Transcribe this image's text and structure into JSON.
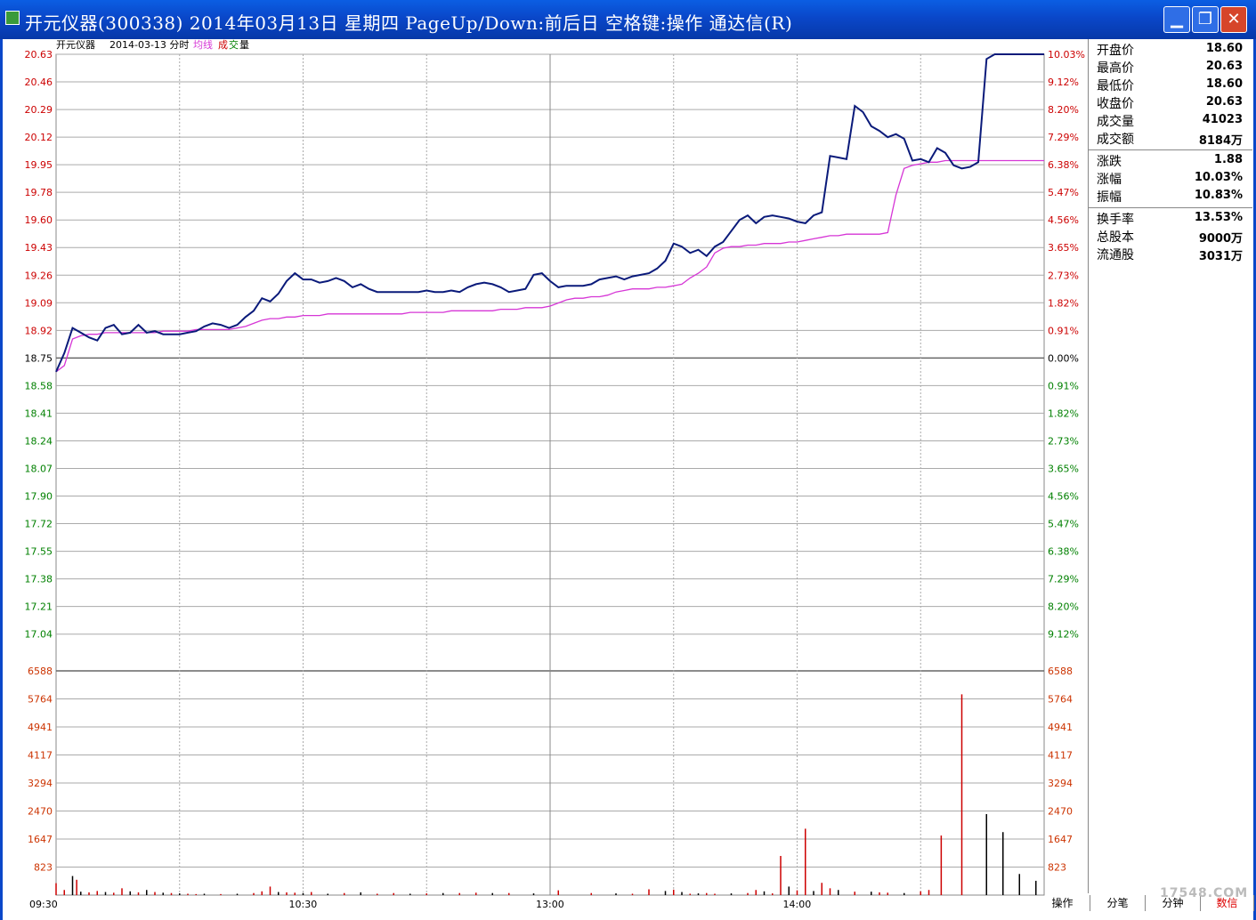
{
  "window": {
    "title": "开元仪器(300338) 2014年03月13日 星期四 PageUp/Down:前后日 空格键:操作 通达信(R)",
    "min_label": "▁",
    "max_label": "❐",
    "close_label": "✕"
  },
  "header": {
    "stock_name": "开元仪器",
    "date_label": "2014-03-13 分时",
    "avg_label": "均线",
    "vol_label_a": "成",
    "vol_label_b": "交",
    "vol_label_c": "量"
  },
  "colors": {
    "price": "#0a1a7a",
    "avg": "#d636d6",
    "up": "#cc0000",
    "down": "#008000",
    "vol_up": "#cc0000",
    "vol_down": "#000000"
  },
  "chart_data": {
    "type": "line",
    "title": "开元仪器 2014-03-13 分时",
    "prev_close": 18.75,
    "price_axis_left": [
      "20.63",
      "20.46",
      "20.29",
      "20.12",
      "19.95",
      "19.78",
      "19.60",
      "19.43",
      "19.26",
      "19.09",
      "18.92",
      "18.75",
      "18.58",
      "18.41",
      "18.24",
      "18.07",
      "17.90",
      "17.72",
      "17.55",
      "17.38",
      "17.21",
      "17.04"
    ],
    "percent_axis_right": [
      "10.03%",
      "9.12%",
      "8.20%",
      "7.29%",
      "6.38%",
      "5.47%",
      "4.56%",
      "3.65%",
      "2.73%",
      "1.82%",
      "0.91%",
      "0.00%",
      "0.91%",
      "1.82%",
      "2.73%",
      "3.65%",
      "4.56%",
      "5.47%",
      "6.38%",
      "7.29%",
      "8.20%",
      "9.12%"
    ],
    "volume_axis": [
      "6588",
      "5764",
      "4941",
      "4117",
      "3294",
      "2470",
      "1647",
      "823"
    ],
    "time_labels": [
      "09:30",
      "10:30",
      "13:00",
      "14:00"
    ],
    "ylim_price": [
      16.87,
      20.63
    ],
    "ylim_volume": [
      0,
      6588
    ],
    "series": [
      {
        "name": "价格",
        "x": [
          0,
          2,
          4,
          6,
          8,
          10,
          12,
          14,
          16,
          18,
          20,
          22,
          24,
          26,
          28,
          30,
          32,
          34,
          36,
          38,
          40,
          42,
          44,
          46,
          48,
          50,
          52,
          54,
          56,
          58,
          60,
          62,
          64,
          66,
          68,
          70,
          72,
          74,
          76,
          78,
          80,
          82,
          84,
          86,
          88,
          90,
          92,
          94,
          96,
          98,
          100,
          102,
          104,
          106,
          108,
          110,
          112,
          114,
          116,
          118,
          120,
          122,
          124,
          126,
          128,
          130,
          132,
          134,
          136,
          138,
          140,
          142,
          144,
          146,
          148,
          150,
          152,
          154,
          156,
          158,
          160,
          162,
          164,
          166,
          168,
          170,
          172,
          174,
          176,
          178,
          180,
          182,
          184,
          186,
          188,
          190,
          192,
          194,
          196,
          198,
          200,
          202,
          204,
          206,
          208,
          210,
          212,
          214,
          216,
          218,
          220,
          222,
          224,
          226,
          228,
          230,
          232,
          234,
          236,
          238,
          240
        ],
        "values": [
          18.6,
          18.72,
          18.88,
          18.85,
          18.82,
          18.8,
          18.88,
          18.9,
          18.84,
          18.85,
          18.9,
          18.85,
          18.86,
          18.84,
          18.84,
          18.84,
          18.85,
          18.86,
          18.89,
          18.91,
          18.9,
          18.88,
          18.9,
          18.95,
          18.99,
          19.07,
          19.05,
          19.1,
          19.18,
          19.23,
          19.19,
          19.19,
          19.17,
          19.18,
          19.2,
          19.18,
          19.14,
          19.16,
          19.13,
          19.11,
          19.11,
          19.11,
          19.11,
          19.11,
          19.11,
          19.12,
          19.11,
          19.11,
          19.12,
          19.11,
          19.14,
          19.16,
          19.17,
          19.16,
          19.14,
          19.11,
          19.12,
          19.13,
          19.22,
          19.23,
          19.18,
          19.14,
          19.15,
          19.15,
          19.15,
          19.16,
          19.19,
          19.2,
          19.21,
          19.19,
          19.21,
          19.22,
          19.23,
          19.26,
          19.31,
          19.42,
          19.4,
          19.36,
          19.38,
          19.34,
          19.4,
          19.43,
          19.5,
          19.57,
          19.6,
          19.55,
          19.59,
          19.6,
          19.59,
          19.58,
          19.56,
          19.55,
          19.6,
          19.62,
          19.98,
          19.97,
          19.96,
          20.3,
          20.26,
          20.17,
          20.14,
          20.1,
          20.12,
          20.09,
          19.95,
          19.96,
          19.94,
          20.03,
          20.0,
          19.92,
          19.9,
          19.91,
          19.94,
          20.6,
          20.63,
          20.63,
          20.63,
          20.63,
          20.63,
          20.63,
          20.63
        ]
      },
      {
        "name": "均线",
        "x": [
          0,
          2,
          4,
          6,
          8,
          10,
          12,
          14,
          16,
          18,
          20,
          22,
          24,
          26,
          28,
          30,
          32,
          34,
          36,
          38,
          40,
          42,
          44,
          46,
          48,
          50,
          52,
          54,
          56,
          58,
          60,
          62,
          64,
          66,
          68,
          70,
          72,
          74,
          76,
          78,
          80,
          82,
          84,
          86,
          88,
          90,
          92,
          94,
          96,
          98,
          100,
          102,
          104,
          106,
          108,
          110,
          112,
          114,
          116,
          118,
          120,
          122,
          124,
          126,
          128,
          130,
          132,
          134,
          136,
          138,
          140,
          142,
          144,
          146,
          148,
          150,
          152,
          154,
          156,
          158,
          160,
          162,
          164,
          166,
          168,
          170,
          172,
          174,
          176,
          178,
          180,
          182,
          184,
          186,
          188,
          190,
          192,
          194,
          196,
          198,
          200,
          202,
          204,
          206,
          208,
          210,
          212,
          214,
          216,
          218,
          220,
          222,
          224,
          226,
          228,
          230,
          232,
          234,
          236,
          238,
          240
        ],
        "values": [
          18.6,
          18.64,
          18.81,
          18.83,
          18.84,
          18.84,
          18.85,
          18.85,
          18.85,
          18.85,
          18.85,
          18.85,
          18.85,
          18.86,
          18.86,
          18.86,
          18.86,
          18.87,
          18.87,
          18.87,
          18.87,
          18.87,
          18.88,
          18.89,
          18.91,
          18.93,
          18.94,
          18.94,
          18.95,
          18.95,
          18.96,
          18.96,
          18.96,
          18.97,
          18.97,
          18.97,
          18.97,
          18.97,
          18.97,
          18.97,
          18.97,
          18.97,
          18.97,
          18.98,
          18.98,
          18.98,
          18.98,
          18.98,
          18.99,
          18.99,
          18.99,
          18.99,
          18.99,
          18.99,
          19.0,
          19.0,
          19.0,
          19.01,
          19.01,
          19.01,
          19.02,
          19.04,
          19.06,
          19.07,
          19.07,
          19.08,
          19.08,
          19.09,
          19.11,
          19.12,
          19.13,
          19.13,
          19.13,
          19.14,
          19.14,
          19.15,
          19.16,
          19.2,
          19.23,
          19.27,
          19.36,
          19.39,
          19.4,
          19.4,
          19.41,
          19.41,
          19.42,
          19.42,
          19.42,
          19.43,
          19.43,
          19.44,
          19.45,
          19.46,
          19.47,
          19.47,
          19.48,
          19.48,
          19.48,
          19.48,
          19.48,
          19.49,
          19.73,
          19.9,
          19.92,
          19.93,
          19.94,
          19.94,
          19.95,
          19.95,
          19.95,
          19.95,
          19.95,
          19.95,
          19.95,
          19.95,
          19.95,
          19.95,
          19.95,
          19.95,
          19.95
        ]
      }
    ],
    "volume": {
      "x": [
        0,
        2,
        4,
        5,
        6,
        8,
        10,
        12,
        14,
        16,
        18,
        20,
        22,
        24,
        26,
        28,
        30,
        32,
        34,
        36,
        40,
        44,
        48,
        50,
        52,
        54,
        56,
        58,
        60,
        62,
        66,
        70,
        74,
        78,
        82,
        86,
        90,
        94,
        98,
        102,
        106,
        110,
        116,
        122,
        130,
        136,
        140,
        144,
        148,
        150,
        152,
        154,
        156,
        158,
        160,
        164,
        168,
        170,
        172,
        174,
        176,
        178,
        180,
        182,
        184,
        186,
        188,
        190,
        194,
        198,
        200,
        202,
        206,
        210,
        212,
        215,
        220,
        226,
        230,
        234,
        238
      ],
      "values": [
        350,
        150,
        560,
        450,
        100,
        80,
        120,
        90,
        70,
        200,
        110,
        80,
        150,
        90,
        70,
        60,
        50,
        40,
        30,
        40,
        30,
        40,
        60,
        110,
        250,
        90,
        80,
        70,
        60,
        90,
        40,
        60,
        80,
        40,
        60,
        40,
        50,
        60,
        60,
        70,
        60,
        60,
        50,
        140,
        60,
        50,
        40,
        170,
        120,
        160,
        90,
        40,
        50,
        60,
        40,
        50,
        60,
        150,
        110,
        50,
        1150,
        250,
        140,
        1950,
        120,
        360,
        200,
        150,
        100,
        100,
        80,
        70,
        60,
        110,
        150,
        1750,
        5900,
        2380,
        1850,
        620,
        420
      ],
      "up": [
        true,
        true,
        false,
        true,
        false,
        true,
        true,
        false,
        true,
        true,
        false,
        true,
        false,
        true,
        false,
        true,
        false,
        true,
        true,
        false,
        true,
        false,
        true,
        true,
        true,
        false,
        true,
        true,
        false,
        true,
        false,
        true,
        false,
        true,
        true,
        false,
        true,
        false,
        true,
        true,
        false,
        true,
        false,
        true,
        true,
        false,
        true,
        true,
        false,
        true,
        false,
        true,
        false,
        true,
        true,
        false,
        true,
        true,
        false,
        true,
        true,
        false,
        true,
        true,
        false,
        true,
        true,
        false,
        true,
        false,
        true,
        true,
        false,
        true,
        true,
        true,
        true,
        false,
        false,
        false,
        false
      ]
    }
  },
  "info": {
    "rows1": [
      {
        "label": "开盘价",
        "value": "18.60"
      },
      {
        "label": "最高价",
        "value": "20.63"
      },
      {
        "label": "最低价",
        "value": "18.60"
      },
      {
        "label": "收盘价",
        "value": "20.63"
      },
      {
        "label": "成交量",
        "value": "41023"
      },
      {
        "label": "成交额",
        "value": "8184万"
      }
    ],
    "rows2": [
      {
        "label": "涨跌",
        "value": "1.88"
      },
      {
        "label": "涨幅",
        "value": "10.03%"
      },
      {
        "label": "振幅",
        "value": "10.83%"
      }
    ],
    "rows3": [
      {
        "label": "换手率",
        "value": "13.53%"
      },
      {
        "label": "总股本",
        "value": "9000万"
      },
      {
        "label": "流通股",
        "value": "3031万"
      }
    ]
  },
  "tabs": [
    "操作",
    "分笔",
    "分钟",
    "数信"
  ],
  "watermark": "17548.COM"
}
